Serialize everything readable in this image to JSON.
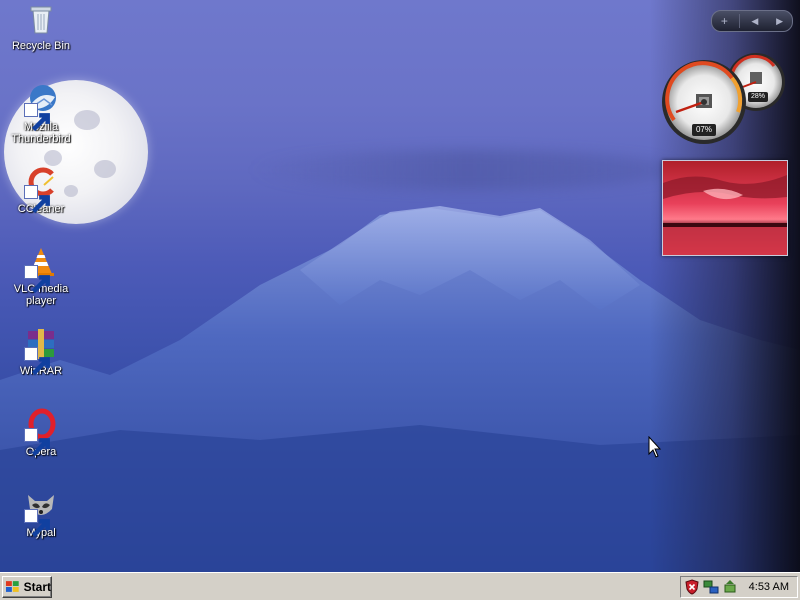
{
  "desktop_icons": [
    {
      "label": "Recycle Bin",
      "icon": "recycle-bin-icon"
    },
    {
      "label": "Mozilla Thunderbird",
      "icon": "thunderbird-icon"
    },
    {
      "label": "CCleaner",
      "icon": "ccleaner-icon"
    },
    {
      "label": "VLC media player",
      "icon": "vlc-icon"
    },
    {
      "label": "WinRAR",
      "icon": "winrar-icon"
    },
    {
      "label": "Opera",
      "icon": "opera-icon"
    },
    {
      "label": "Mypal",
      "icon": "mypal-icon"
    }
  ],
  "gadgets": {
    "toolbar": {
      "add": "+",
      "prev": "◀",
      "next": "▶"
    },
    "cpu_meter": {
      "cpu_percent": "07%",
      "memory_percent": "28%"
    },
    "slideshow": {
      "icon": "sunset-photo"
    }
  },
  "taskbar": {
    "start_label": "Start",
    "clock": "4:53 AM",
    "tray_icons": [
      "security-shield-icon",
      "network-icon",
      "safely-remove-icon"
    ]
  },
  "colors": {
    "taskbar_bg": "#d4d0c8",
    "sky_top": "#6f78cc",
    "mountain": "#3a55b0"
  }
}
